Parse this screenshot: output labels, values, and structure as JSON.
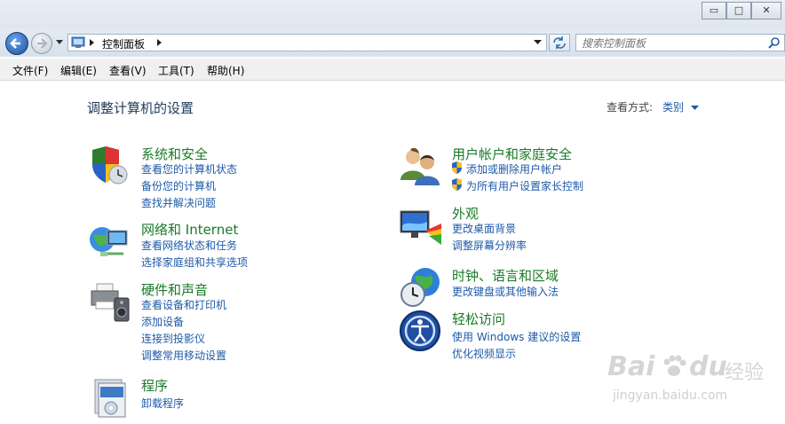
{
  "window": {
    "minimize_glyph": "▭",
    "maximize_glyph": "□",
    "close_glyph": "✕"
  },
  "address": {
    "breadcrumb": "控制面板",
    "search_placeholder": "搜索控制面板"
  },
  "menu": [
    "文件(F)",
    "编辑(E)",
    "查看(V)",
    "工具(T)",
    "帮助(H)"
  ],
  "main": {
    "title": "调整计算机的设置",
    "view_by_label": "查看方式:",
    "view_by_value": "类别"
  },
  "categories": [
    {
      "title": "系统和安全",
      "icon": "shield-clock-icon",
      "links": [
        "查看您的计算机状态",
        "备份您的计算机",
        "查找并解决问题"
      ]
    },
    {
      "title": "网络和 Internet",
      "icon": "network-globe-icon",
      "links": [
        "查看网络状态和任务",
        "选择家庭组和共享选项"
      ]
    },
    {
      "title": "硬件和声音",
      "icon": "printer-speaker-icon",
      "links": [
        "查看设备和打印机",
        "添加设备",
        "连接到投影仪",
        "调整常用移动设置"
      ]
    },
    {
      "title": "程序",
      "icon": "programs-icon",
      "links": [
        "卸载程序"
      ]
    },
    {
      "title": "用户帐户和家庭安全",
      "icon": "users-icon",
      "links": [
        "添加或删除用户帐户",
        "为所有用户设置家长控制"
      ]
    },
    {
      "title": "外观",
      "icon": "monitor-palette-icon",
      "links": [
        "更改桌面背景",
        "调整屏幕分辨率"
      ]
    },
    {
      "title": "时钟、语言和区域",
      "icon": "clock-globe-icon",
      "links": [
        "更改键盘或其他输入法"
      ]
    },
    {
      "title": "轻松访问",
      "icon": "ease-of-access-icon",
      "links": [
        "使用 Windows 建议的设置",
        "优化视频显示"
      ]
    }
  ],
  "watermark": {
    "brand": "Bai",
    "brand2": "du",
    "suffix": "经验",
    "url": "jingyan.baidu.com"
  }
}
